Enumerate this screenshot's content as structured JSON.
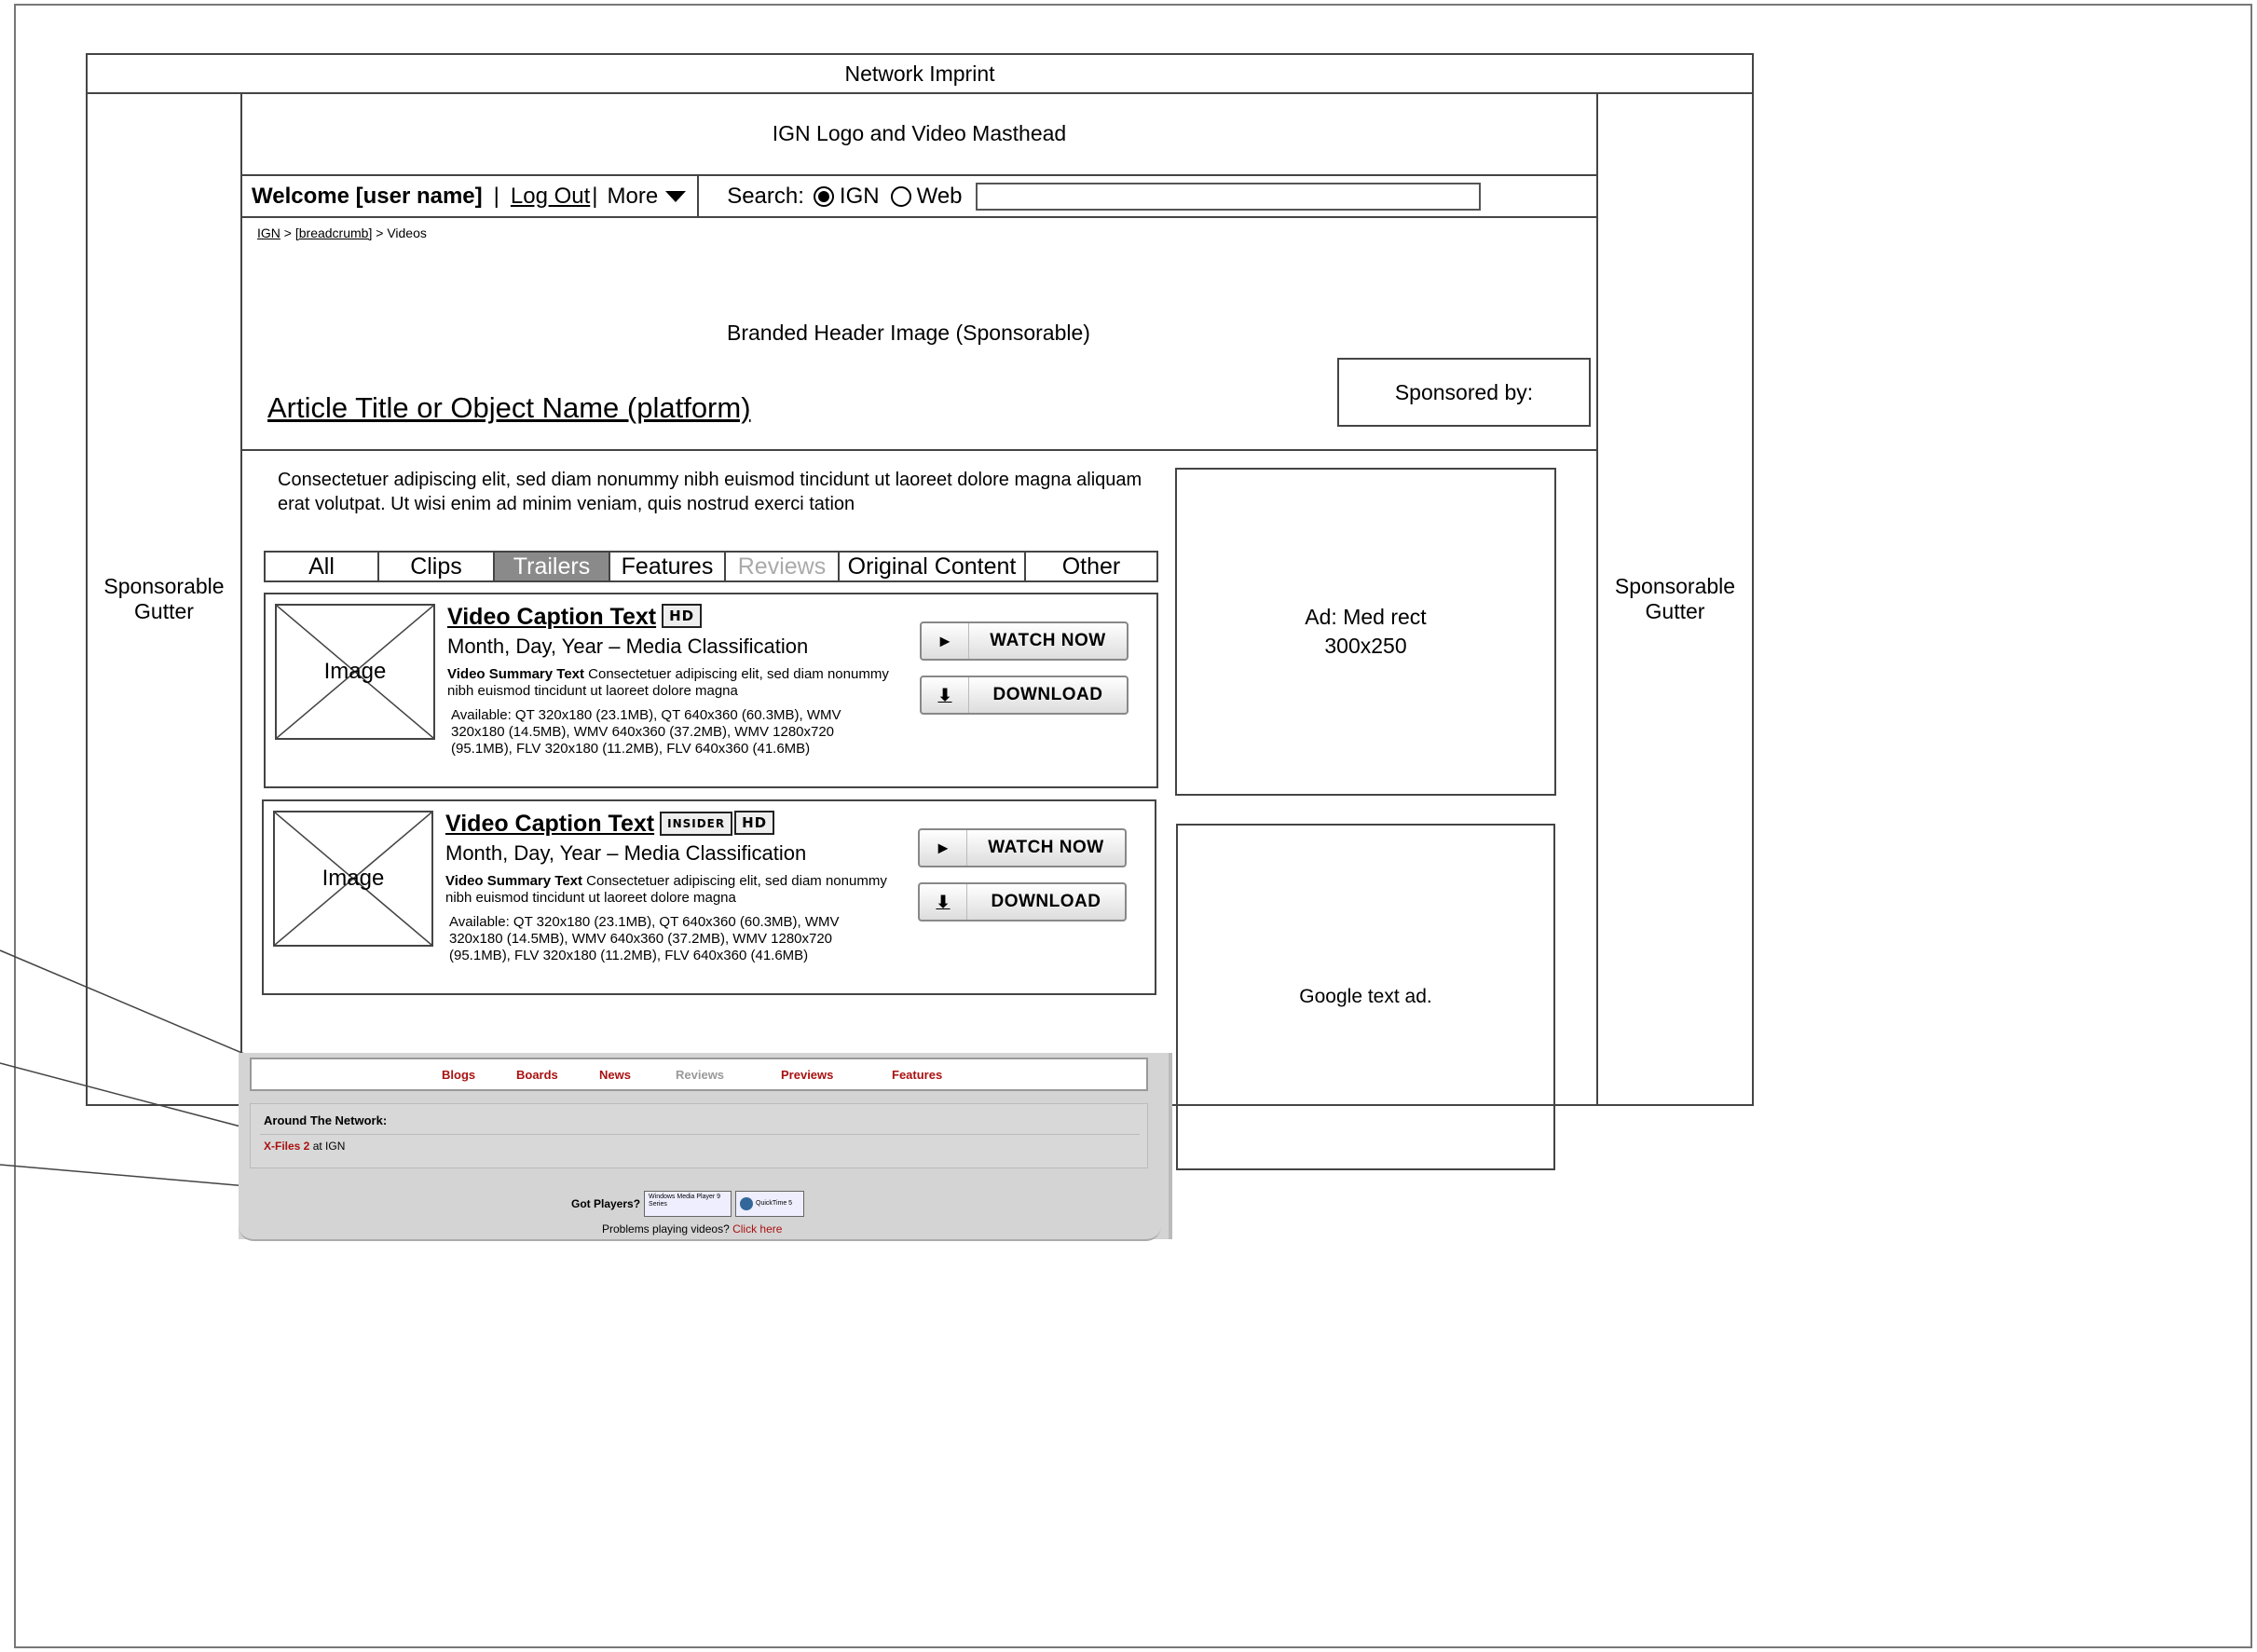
{
  "imprint": "Network Imprint",
  "masthead": "IGN Logo and Video Masthead",
  "userbar": {
    "welcome": "Welcome [user name]",
    "sep1": "|",
    "logout": "Log Out",
    "sep2": "|",
    "more": "More",
    "search_label": "Search:",
    "radio_ign": "IGN",
    "radio_web": "Web",
    "search_value": ""
  },
  "breadcrumb": {
    "home": "IGN",
    "sep1": " > ",
    "middle": "[breadcrumb]",
    "sep2": " > ",
    "current": "Videos"
  },
  "header": {
    "branded": "Branded Header Image (Sponsorable)",
    "title": "Article Title or Object Name (platform)",
    "sponsored": "Sponsored by:"
  },
  "gutter": {
    "left": "Sponsorable Gutter",
    "right": "Sponsorable Gutter"
  },
  "intro": "Consectetuer adipiscing elit, sed diam nonummy nibh euismod tincidunt ut laoreet dolore magna aliquam erat volutpat. Ut wisi enim ad minim veniam, quis nostrud exerci tation",
  "tabs": [
    {
      "label": "All"
    },
    {
      "label": "Clips"
    },
    {
      "label": "Trailers"
    },
    {
      "label": "Features"
    },
    {
      "label": "Reviews"
    },
    {
      "label": "Original Content"
    },
    {
      "label": "Other"
    }
  ],
  "videos": [
    {
      "image": "Image",
      "caption": "Video Caption Text",
      "badges": [
        "HD"
      ],
      "meta": "Month, Day, Year – Media Classification",
      "summary_bold": "Video Summary Text",
      "summary": " Consectetuer adipiscing elit, sed diam nonummy nibh euismod tincidunt ut laoreet dolore magna",
      "available": "Available: QT 320x180 (23.1MB), QT 640x360 (60.3MB), WMV 320x180 (14.5MB), WMV 640x360 (37.2MB), WMV 1280x720 (95.1MB), FLV 320x180 (11.2MB), FLV 640x360 (41.6MB)",
      "watch": "WATCH NOW",
      "download": "DOWNLOAD"
    },
    {
      "image": "Image",
      "caption": "Video Caption Text",
      "badges": [
        "INSIDER",
        "HD"
      ],
      "meta": "Month, Day, Year – Media Classification",
      "summary_bold": "Video Summary Text",
      "summary": " Consectetuer adipiscing elit, sed diam nonummy nibh euismod tincidunt ut laoreet dolore magna",
      "available": "Available: QT 320x180 (23.1MB), QT 640x360 (60.3MB), WMV 320x180 (14.5MB), WMV 640x360 (37.2MB), WMV 1280x720 (95.1MB), FLV 320x180 (11.2MB), FLV 640x360 (41.6MB)",
      "watch": "WATCH NOW",
      "download": "DOWNLOAD"
    }
  ],
  "ads": {
    "med_rect": "Ad: Med rect",
    "med_rect_size": "300x250",
    "google": "Google text ad."
  },
  "bottom_nav": [
    "Blogs",
    "Boards",
    "News",
    "Reviews",
    "Previews",
    "Features"
  ],
  "network": {
    "heading": "Around The Network:",
    "link": "X-Files 2",
    "suffix": " at IGN"
  },
  "players": {
    "label": "Got Players?",
    "wmp": "Windows Media Player 9 Series",
    "qt": "QuickTime 5",
    "problem": "Problems playing videos?",
    "click": "Click here"
  },
  "colors": {
    "accent_red": "#aa1111",
    "active_tab": "#8a8a8a",
    "module_gray": "#d4d4d4"
  }
}
